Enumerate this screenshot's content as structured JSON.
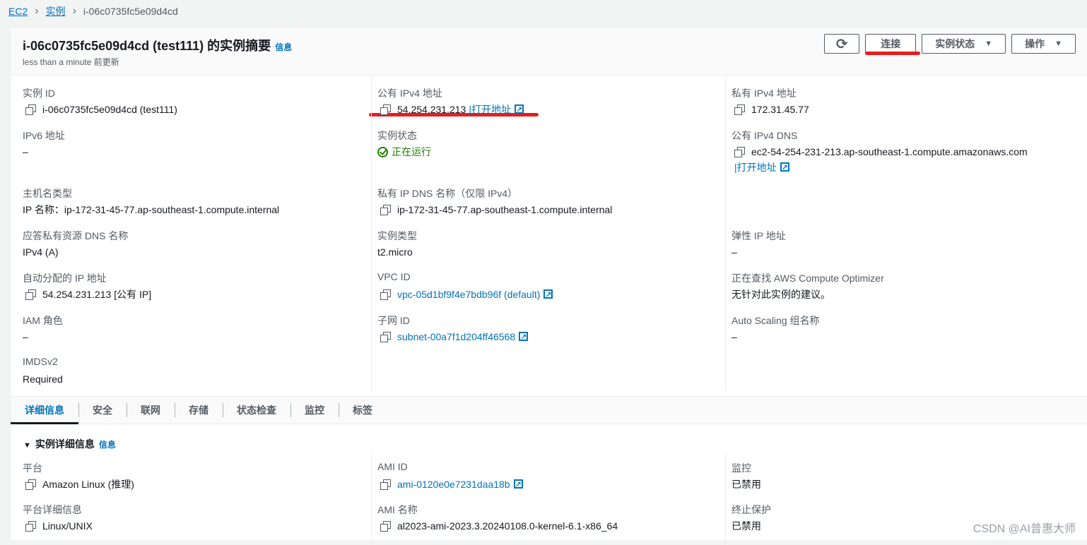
{
  "breadcrumb": [
    "EC2",
    "实例",
    "i-06c0735fc5e09d4cd"
  ],
  "header": {
    "title": "i-06c0735fc5e09d4cd (test111) 的实例摘要",
    "info": "信息",
    "updated": "less than a minute 前更新"
  },
  "buttons": {
    "refresh": "⟳",
    "connect": "连接",
    "instance_state": "实例状态",
    "actions": "操作",
    "caret": "▼"
  },
  "summary": {
    "col1": [
      {
        "label": "实例 ID",
        "value": "i-06c0735fc5e09d4cd (test111)",
        "copy": true
      },
      {
        "label": "IPv6 地址",
        "value": "–"
      },
      {
        "label": "主机名类型",
        "value": "IP 名称：ip-172-31-45-77.ap-southeast-1.compute.internal"
      },
      {
        "label": "应答私有资源 DNS 名称",
        "value": "IPv4 (A)"
      },
      {
        "label": "自动分配的 IP 地址",
        "value": "54.254.231.213 [公有 IP]",
        "copy": true
      },
      {
        "label": "IAM 角色",
        "value": "–"
      },
      {
        "label": "IMDSv2",
        "value": "Required"
      }
    ],
    "col2": [
      {
        "label": "公有 IPv4 地址",
        "value": "54.254.231.213",
        "copy": true,
        "open": "|打开地址"
      },
      {
        "label": "实例状态",
        "value": "正在运行",
        "status": "running"
      },
      {
        "label": "私有 IP DNS 名称（仅限 IPv4）",
        "value": "ip-172-31-45-77.ap-southeast-1.compute.internal",
        "copy": true
      },
      {
        "label": "实例类型",
        "value": "t2.micro"
      },
      {
        "label": "VPC ID",
        "value": "vpc-05d1bf9f4e7bdb96f (default)",
        "copy": true,
        "link": true
      },
      {
        "label": "子网 ID",
        "value": "subnet-00a7f1d204ff46568",
        "copy": true,
        "link": true
      }
    ],
    "col3": [
      {
        "label": "私有 IPv4 地址",
        "value": "172.31.45.77",
        "copy": true
      },
      {
        "label": "公有 IPv4 DNS",
        "value": "ec2-54-254-231-213.ap-southeast-1.compute.amazonaws.com",
        "copy": true,
        "open": "|打开地址"
      },
      {
        "label": "弹性 IP 地址",
        "value": "–"
      },
      {
        "label": "正在查找 AWS Compute Optimizer",
        "value": "无针对此实例的建议。"
      },
      {
        "label": "Auto Scaling 组名称",
        "value": "–"
      }
    ]
  },
  "tabs": [
    "详细信息",
    "安全",
    "联网",
    "存储",
    "状态检查",
    "监控",
    "标签"
  ],
  "details": {
    "title": "实例详细信息",
    "info": "信息",
    "toggle": "▼",
    "col1": [
      {
        "label": "平台",
        "value": "Amazon Linux (推理)",
        "copy": true
      },
      {
        "label": "平台详细信息",
        "value": "Linux/UNIX",
        "copy": true
      }
    ],
    "col2": [
      {
        "label": "AMI ID",
        "value": "ami-0120e0e7231daa18b",
        "copy": true,
        "link": true
      },
      {
        "label": "AMI 名称",
        "value": "al2023-ami-2023.3.20240108.0-kernel-6.1-x86_64",
        "copy": true
      }
    ],
    "col3": [
      {
        "label": "监控",
        "value": "已禁用"
      },
      {
        "label": "终止保护",
        "value": "已禁用"
      }
    ]
  },
  "watermark": "CSDN @AI普惠大师"
}
